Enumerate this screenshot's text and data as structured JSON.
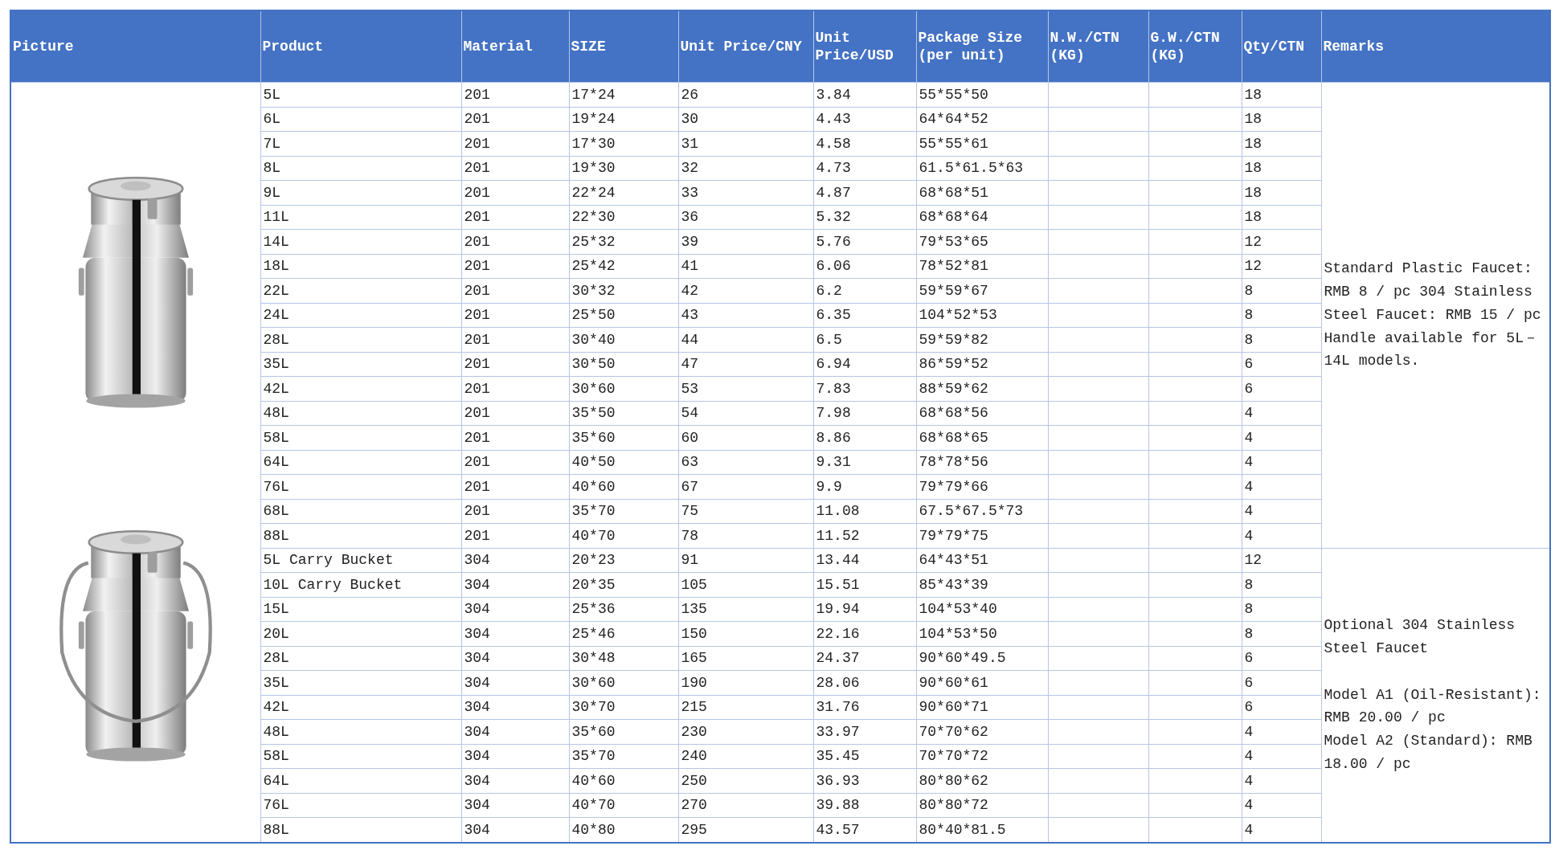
{
  "table": {
    "columns": [
      "Picture",
      "Product",
      "Material",
      "SIZE",
      "Unit Price/CNY",
      "Unit Price/USD",
      "Package Size (per unit)",
      "N.W./CTN (KG)",
      "G.W./CTN (KG)",
      "Qty/CTN",
      "Remarks"
    ],
    "pictures": [
      {
        "kind": "picture"
      },
      {
        "kind": "picture"
      }
    ],
    "groups": [
      {
        "remarks": "Standard Plastic Faucet: RMB 8 / pc 304 Stainless Steel Faucet: RMB 15 / pc Handle available for 5L－14L models.",
        "rows": [
          {
            "product": "5L",
            "material": "201",
            "size": "17*24",
            "price_cny": "26",
            "price_usd": "3.84",
            "package_size": "55*55*50",
            "qty": "18"
          },
          {
            "product": "6L",
            "material": "201",
            "size": "19*24",
            "price_cny": "30",
            "price_usd": "4.43",
            "package_size": "64*64*52",
            "qty": "18"
          },
          {
            "product": "7L",
            "material": "201",
            "size": "17*30",
            "price_cny": "31",
            "price_usd": "4.58",
            "package_size": "55*55*61",
            "qty": "18"
          },
          {
            "product": "8L",
            "material": "201",
            "size": "19*30",
            "price_cny": "32",
            "price_usd": "4.73",
            "package_size": "61.5*61.5*63",
            "qty": "18"
          },
          {
            "product": "9L",
            "material": "201",
            "size": "22*24",
            "price_cny": "33",
            "price_usd": "4.87",
            "package_size": "68*68*51",
            "qty": "18"
          },
          {
            "product": "11L",
            "material": "201",
            "size": "22*30",
            "price_cny": "36",
            "price_usd": "5.32",
            "package_size": "68*68*64",
            "qty": "18"
          },
          {
            "product": "14L",
            "material": "201",
            "size": "25*32",
            "price_cny": "39",
            "price_usd": "5.76",
            "package_size": "79*53*65",
            "qty": "12"
          },
          {
            "product": "18L",
            "material": "201",
            "size": "25*42",
            "price_cny": "41",
            "price_usd": "6.06",
            "package_size": "78*52*81",
            "qty": "12"
          },
          {
            "product": "22L",
            "material": "201",
            "size": "30*32",
            "price_cny": "42",
            "price_usd": "6.2",
            "package_size": "59*59*67",
            "qty": "8"
          },
          {
            "product": "24L",
            "material": "201",
            "size": "25*50",
            "price_cny": "43",
            "price_usd": "6.35",
            "package_size": "104*52*53",
            "qty": "8"
          },
          {
            "product": "28L",
            "material": "201",
            "size": "30*40",
            "price_cny": "44",
            "price_usd": "6.5",
            "package_size": "59*59*82",
            "qty": "8"
          },
          {
            "product": "35L",
            "material": "201",
            "size": "30*50",
            "price_cny": "47",
            "price_usd": "6.94",
            "package_size": "86*59*52",
            "qty": "6"
          },
          {
            "product": "42L",
            "material": "201",
            "size": "30*60",
            "price_cny": "53",
            "price_usd": "7.83",
            "package_size": "88*59*62",
            "qty": "6"
          },
          {
            "product": "48L",
            "material": "201",
            "size": "35*50",
            "price_cny": "54",
            "price_usd": "7.98",
            "package_size": "68*68*56",
            "qty": "4"
          },
          {
            "product": "58L",
            "material": "201",
            "size": "35*60",
            "price_cny": "60",
            "price_usd": "8.86",
            "package_size": "68*68*65",
            "qty": "4"
          },
          {
            "product": "64L",
            "material": "201",
            "size": "40*50",
            "price_cny": "63",
            "price_usd": "9.31",
            "package_size": "78*78*56",
            "qty": "4"
          },
          {
            "product": "76L",
            "material": "201",
            "size": "40*60",
            "price_cny": "67",
            "price_usd": "9.9",
            "package_size": "79*79*66",
            "qty": "4"
          },
          {
            "product": "68L",
            "material": "201",
            "size": "35*70",
            "price_cny": "75",
            "price_usd": "11.08",
            "package_size": "67.5*67.5*73",
            "qty": "4"
          },
          {
            "product": "88L",
            "material": "201",
            "size": "40*70",
            "price_cny": "78",
            "price_usd": "11.52",
            "package_size": "79*79*75",
            "qty": "4"
          }
        ]
      },
      {
        "remarks": "Optional 304 Stainless Steel Faucet\n\nModel A1 (Oil-Resistant): RMB 20.00 / pc\nModel A2 (Standard): RMB 18.00 / pc",
        "rows": [
          {
            "product": "5L Carry Bucket",
            "material": "304",
            "size": "20*23",
            "price_cny": "91",
            "price_usd": "13.44",
            "package_size": "64*43*51",
            "qty": "12"
          },
          {
            "product": "10L Carry Bucket",
            "material": "304",
            "size": "20*35",
            "price_cny": "105",
            "price_usd": "15.51",
            "package_size": "85*43*39",
            "qty": "8"
          },
          {
            "product": "15L",
            "material": "304",
            "size": "25*36",
            "price_cny": "135",
            "price_usd": "19.94",
            "package_size": "104*53*40",
            "qty": "8"
          },
          {
            "product": "20L",
            "material": "304",
            "size": "25*46",
            "price_cny": "150",
            "price_usd": "22.16",
            "package_size": "104*53*50",
            "qty": "8"
          },
          {
            "product": "28L",
            "material": "304",
            "size": "30*48",
            "price_cny": "165",
            "price_usd": "24.37",
            "package_size": "90*60*49.5",
            "qty": "6"
          },
          {
            "product": "35L",
            "material": "304",
            "size": "30*60",
            "price_cny": "190",
            "price_usd": "28.06",
            "package_size": "90*60*61",
            "qty": "6"
          },
          {
            "product": "42L",
            "material": "304",
            "size": "30*70",
            "price_cny": "215",
            "price_usd": "31.76",
            "package_size": "90*60*71",
            "qty": "6"
          },
          {
            "product": "48L",
            "material": "304",
            "size": "35*60",
            "price_cny": "230",
            "price_usd": "33.97",
            "package_size": "70*70*62",
            "qty": "4"
          },
          {
            "product": "58L",
            "material": "304",
            "size": "35*70",
            "price_cny": "240",
            "price_usd": "35.45",
            "package_size": "70*70*72",
            "qty": "4"
          },
          {
            "product": "64L",
            "material": "304",
            "size": "40*60",
            "price_cny": "250",
            "price_usd": "36.93",
            "package_size": "80*80*62",
            "qty": "4"
          },
          {
            "product": "76L",
            "material": "304",
            "size": "40*70",
            "price_cny": "270",
            "price_usd": "39.88",
            "package_size": "80*80*72",
            "qty": "4"
          },
          {
            "product": "88L",
            "material": "304",
            "size": "40*80",
            "price_cny": "295",
            "price_usd": "43.57",
            "package_size": "80*40*81.5",
            "qty": "4"
          }
        ]
      }
    ]
  }
}
